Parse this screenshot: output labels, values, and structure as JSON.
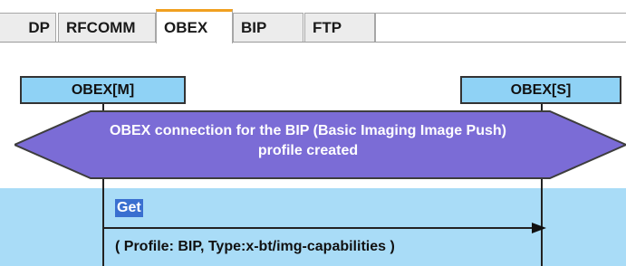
{
  "tabs": [
    {
      "label": "DP"
    },
    {
      "label": "RFCOMM"
    },
    {
      "label": "OBEX"
    },
    {
      "label": "BIP"
    },
    {
      "label": "FTP"
    }
  ],
  "active_tab": "OBEX",
  "diagram": {
    "entities": [
      {
        "label": "OBEX[M]"
      },
      {
        "label": "OBEX[S]"
      }
    ],
    "connection_banner": {
      "line1": "OBEX connection for the BIP (Basic Imaging Image Push)",
      "line2": "profile created"
    },
    "message": {
      "label": "Get",
      "params": "( Profile: BIP, Type:x-bt/img-capabilities  )"
    }
  },
  "colors": {
    "entity_fill": "#8fd2f5",
    "banner_fill": "#7b6cd6",
    "band_fill": "#a9dcf7",
    "highlight": "#3a6fd0",
    "active_tab_accent": "#f0a020"
  }
}
